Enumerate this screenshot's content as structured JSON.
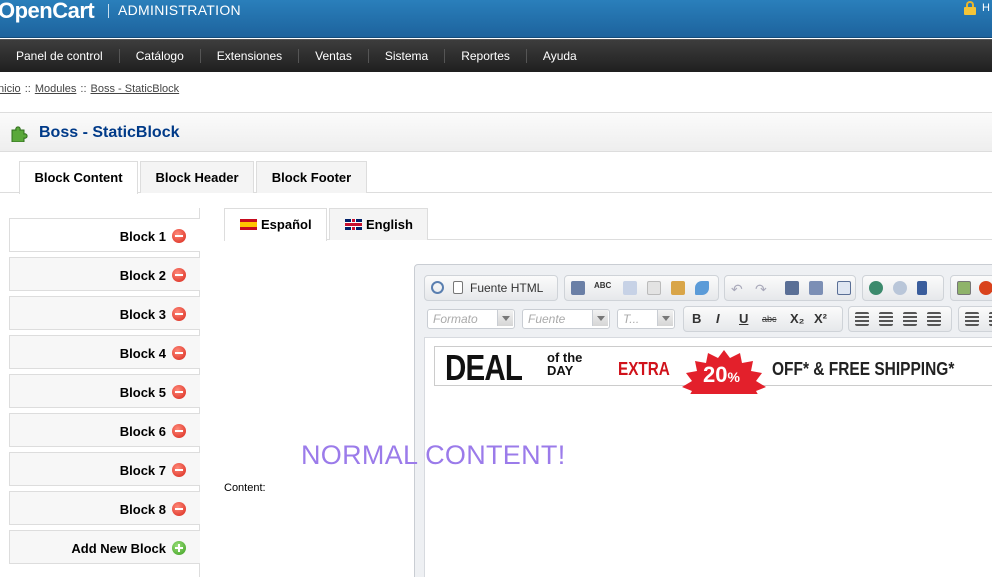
{
  "header": {
    "logo": "OpenCart",
    "admin_title": "ADMINISTRATION",
    "user_text": "H",
    "icons": {
      "lock": "lock-icon"
    }
  },
  "menu": {
    "items": [
      "Panel de control",
      "Catálogo",
      "Extensiones",
      "Ventas",
      "Sistema",
      "Reportes",
      "Ayuda"
    ]
  },
  "breadcrumb": {
    "items": [
      "Inicio",
      "Modules",
      "Boss - StaticBlock"
    ],
    "separator": "::"
  },
  "heading": {
    "title": "Boss - StaticBlock",
    "icon": "puzzle-icon"
  },
  "main_tabs": [
    "Block Content",
    "Block Header",
    "Block Footer"
  ],
  "block_tabs": {
    "items": [
      "Block 1",
      "Block 2",
      "Block 3",
      "Block 4",
      "Block 5",
      "Block 6",
      "Block 7",
      "Block 8"
    ],
    "add_label": "Add New Block"
  },
  "language_tabs": [
    {
      "label": "Español",
      "flag": "spain-flag-icon"
    },
    {
      "label": "English",
      "flag": "uk-flag-icon"
    }
  ],
  "content_label": "Content:",
  "editor": {
    "source_label": "Fuente HTML",
    "format_placeholder": "Formato",
    "font_placeholder": "Fuente",
    "size_placeholder": "T...",
    "bold": "B",
    "italic": "I",
    "underline": "U",
    "strike": "abc",
    "subscript": "X₂",
    "superscript": "X²"
  },
  "banner": {
    "deal": "DEAL",
    "of_the_day": "of the DAY",
    "extra": "EXTRA",
    "percent": "20",
    "percent_sign": "%",
    "offer": "OFF* & FREE SHIPPING*"
  },
  "normal_content": "NORMAL CONTENT!",
  "colors": {
    "header_blue": "#1d639d",
    "menu_dark": "#2b2b2b",
    "heading_title": "#003a88",
    "normal_content": "#9b7bea",
    "deal_red": "#d0121b"
  }
}
